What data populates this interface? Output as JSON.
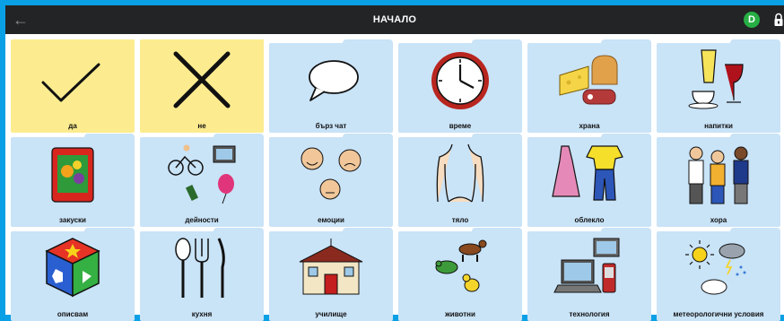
{
  "header": {
    "title": "НАЧАЛО",
    "avatar_letter": "D"
  },
  "tiles": [
    {
      "label": "да",
      "icon": "checkmark-icon",
      "color": "#fcec8f"
    },
    {
      "label": "не",
      "icon": "cross-icon",
      "color": "#fcec8f"
    },
    {
      "label": "бърз чат",
      "icon": "speech-bubble-icon",
      "color": "#c9e3f7"
    },
    {
      "label": "време",
      "icon": "clock-icon",
      "color": "#c9e3f7"
    },
    {
      "label": "храна",
      "icon": "food-icon",
      "color": "#c9e3f7"
    },
    {
      "label": "напитки",
      "icon": "drinks-icon",
      "color": "#c9e3f7"
    },
    {
      "label": "закуски",
      "icon": "snack-bag-icon",
      "color": "#c9e3f7"
    },
    {
      "label": "дейности",
      "icon": "activities-icon",
      "color": "#c9e3f7"
    },
    {
      "label": "емоции",
      "icon": "faces-icon",
      "color": "#c9e3f7"
    },
    {
      "label": "тяло",
      "icon": "body-icon",
      "color": "#c9e3f7"
    },
    {
      "label": "облекло",
      "icon": "clothes-icon",
      "color": "#c9e3f7"
    },
    {
      "label": "хора",
      "icon": "people-icon",
      "color": "#c9e3f7"
    },
    {
      "label": "описвам",
      "icon": "shapes-cube-icon",
      "color": "#c9e3f7"
    },
    {
      "label": "кухня",
      "icon": "cutlery-icon",
      "color": "#c9e3f7"
    },
    {
      "label": "училище",
      "icon": "school-icon",
      "color": "#c9e3f7"
    },
    {
      "label": "животни",
      "icon": "animals-icon",
      "color": "#c9e3f7"
    },
    {
      "label": "технология",
      "icon": "computer-icon",
      "color": "#c9e3f7"
    },
    {
      "label": "метеорологични условия",
      "icon": "weather-icon",
      "color": "#c9e3f7"
    }
  ]
}
